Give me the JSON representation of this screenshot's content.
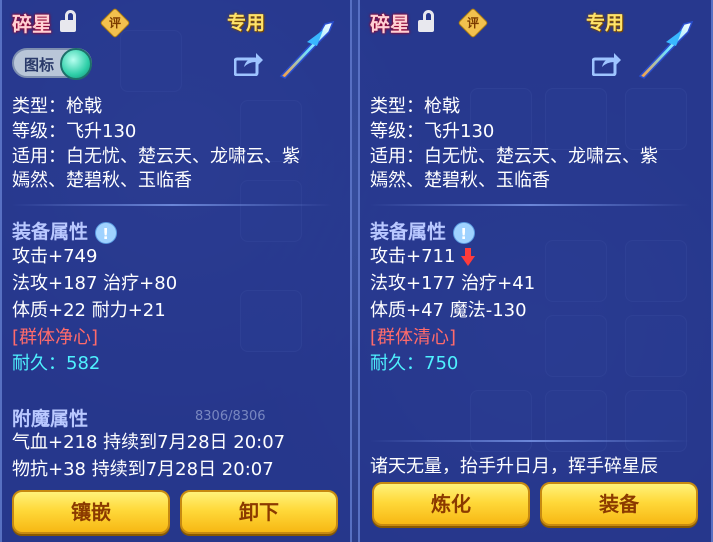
{
  "left": {
    "title": "碎星",
    "rating_badge": "评",
    "exclusive_tag": "专用",
    "icon_toggle_label": "图标",
    "type": "类型：枪戟",
    "level": "等级：飞升130",
    "applicable_line1": "适用：白无忧、楚云天、龙啸云、紫",
    "applicable_line2": "嫣然、楚碧秋、玉临香",
    "attr_header": "装备属性",
    "stat_attack": "攻击+749",
    "stat_magic_heal": "法攻+187 治疗+80",
    "stat_body": "体质+22 耐力+21",
    "skill": "[群体净心]",
    "durability_label": "耐久：",
    "durability_value": "582",
    "enchant_header": "附魔属性",
    "enchant1": "气血+218 持续到7月28日 20:07",
    "enchant2": "物抗+38 持续到7月28日 20:07",
    "btn_inlay": "镶嵌",
    "btn_unequip": "卸下"
  },
  "right": {
    "title": "碎星",
    "rating_badge": "评",
    "exclusive_tag": "专用",
    "type": "类型：枪戟",
    "level": "等级：飞升130",
    "applicable_line1": "适用：白无忧、楚云天、龙啸云、紫",
    "applicable_line2": "嫣然、楚碧秋、玉临香",
    "attr_header": "装备属性",
    "stat_attack": "攻击+711",
    "stat_magic_heal": "法攻+177 治疗+41",
    "stat_body": "体质+47 魔法-130",
    "skill": "[群体清心]",
    "durability_label": "耐久：",
    "durability_value": "750",
    "flavor": "诸天无量，抬手升日月，挥手碎星辰",
    "btn_refine": "炼化",
    "btn_equip": "装备"
  },
  "background": {
    "left_counter": "8306/8306"
  },
  "colors": {
    "panel_bg": "#26368c",
    "title": "#ffd0d4",
    "section": "#b9c8ff",
    "skill_red": "#ff6b6b",
    "durability_cyan": "#4ff2ff",
    "button_gold": "#ffd93a",
    "exclusive_yellow": "#ffe36a"
  },
  "icons": [
    "lock-open-icon",
    "rating-badge-icon",
    "share-icon",
    "weapon-spear-icon",
    "info-tip-icon",
    "stat-decrease-arrow-icon"
  ]
}
